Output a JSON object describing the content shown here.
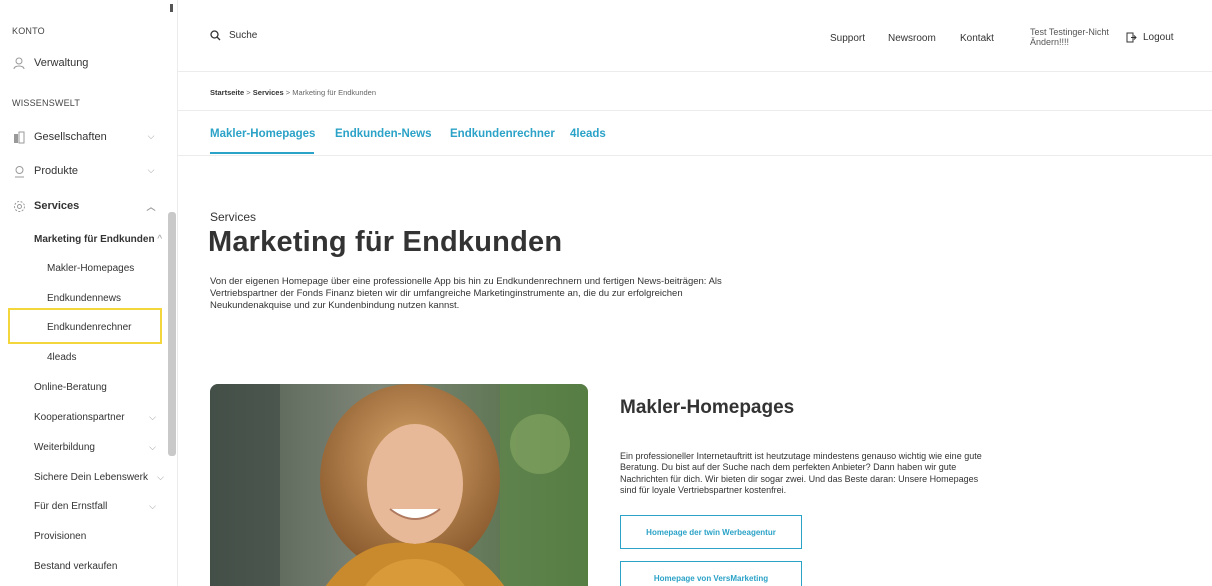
{
  "sidebar": {
    "section_account": "KONTO",
    "verwaltung": "Verwaltung",
    "section_knowledge": "WISSENSWELT",
    "gesellschaften": "Gesellschaften",
    "produkte": "Produkte",
    "services": "Services",
    "marketing": "Marketing für Endkunden",
    "sub_items": [
      "Makler-Homepages",
      "Endkundennews",
      "Endkundenrechner",
      "4leads"
    ],
    "items": [
      "Online-Beratung",
      "Kooperationspartner",
      "Weiterbildung",
      "Sichere Dein Lebenswerk",
      "Für den Ernstfall",
      "Provisionen",
      "Bestand verkaufen"
    ]
  },
  "topbar": {
    "search_label": "Suche",
    "support": "Support",
    "newsroom": "Newsroom",
    "kontakt": "Kontakt",
    "user_name": "Test Testinger-Nicht Ändern!!!!",
    "logout": "Logout"
  },
  "breadcrumbs": [
    "Startseite",
    "Services",
    "Marketing für Endkunden"
  ],
  "breadcrumb_sep": ">",
  "tabs": [
    "Makler-Homepages",
    "Endkunden-News",
    "Endkundenrechner",
    "4leads"
  ],
  "main": {
    "overline": "Services",
    "title": "Marketing für Endkunden",
    "intro": "Von der eigenen Homepage über eine professionelle App bis hin zu Endkundenrechnern und fertigen News-beiträgen: Als Vertriebspartner der Fonds Finanz bieten wir dir umfangreiche Marketinginstrumente an, die du zur erfolgreichen Neukundenakquise und zur Kundenbindung nutzen kannst.",
    "section_title": "Makler-Homepages",
    "section_text": "Ein professioneller Internetauftritt ist heutzutage mindestens genauso wichtig wie eine gute Beratung. Du bist auf der Suche nach dem perfekten Anbieter? Dann haben wir gute Nachrichten für dich. Wir bieten dir sogar zwei. Und das Beste daran: Unsere Homepages sind für loyale Vertriebspartner kostenfrei.",
    "button_1": "Homepage der twin Werbeagentur",
    "button_2": "Homepage von VersMarketing"
  },
  "colors": {
    "accent": "#2ba2c7",
    "highlight": "#f2d63b"
  }
}
